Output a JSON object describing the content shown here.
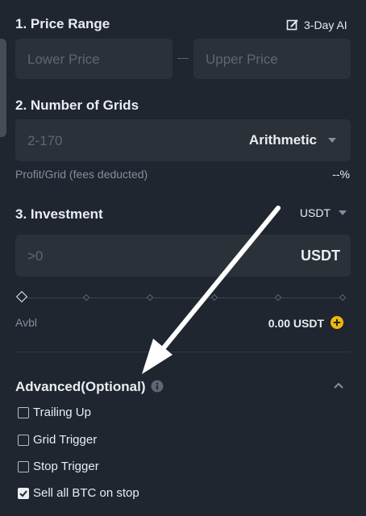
{
  "price_range": {
    "title": "1. Price Range",
    "ai_label": "3-Day AI",
    "lower_placeholder": "Lower Price",
    "separator": "—",
    "upper_placeholder": "Upper Price"
  },
  "grids": {
    "title": "2. Number of Grids",
    "placeholder": "2-170",
    "mode": "Arithmetic",
    "profit_label": "Profit/Grid (fees deducted)",
    "profit_value": "--%"
  },
  "investment": {
    "title": "3. Investment",
    "currency_select": "USDT",
    "placeholder": ">0",
    "unit": "USDT",
    "slider_percent": 0,
    "avbl_label": "Avbl",
    "avbl_value": "0.00 USDT",
    "add_icon": "plus-circle-icon"
  },
  "advanced": {
    "title": "Advanced(Optional)",
    "info_icon": "info-icon",
    "collapse_icon": "chevron-up-icon",
    "options": [
      {
        "label": "Trailing Up",
        "checked": false
      },
      {
        "label": "Grid Trigger",
        "checked": false
      },
      {
        "label": "Stop Trigger",
        "checked": false
      },
      {
        "label": "Sell all BTC on stop",
        "checked": true
      }
    ]
  },
  "colors": {
    "background": "#1f2630",
    "input_bg": "#2b3139",
    "accent_yellow": "#f0b90b",
    "text_primary": "#eaecef",
    "text_muted": "#848e9c"
  }
}
